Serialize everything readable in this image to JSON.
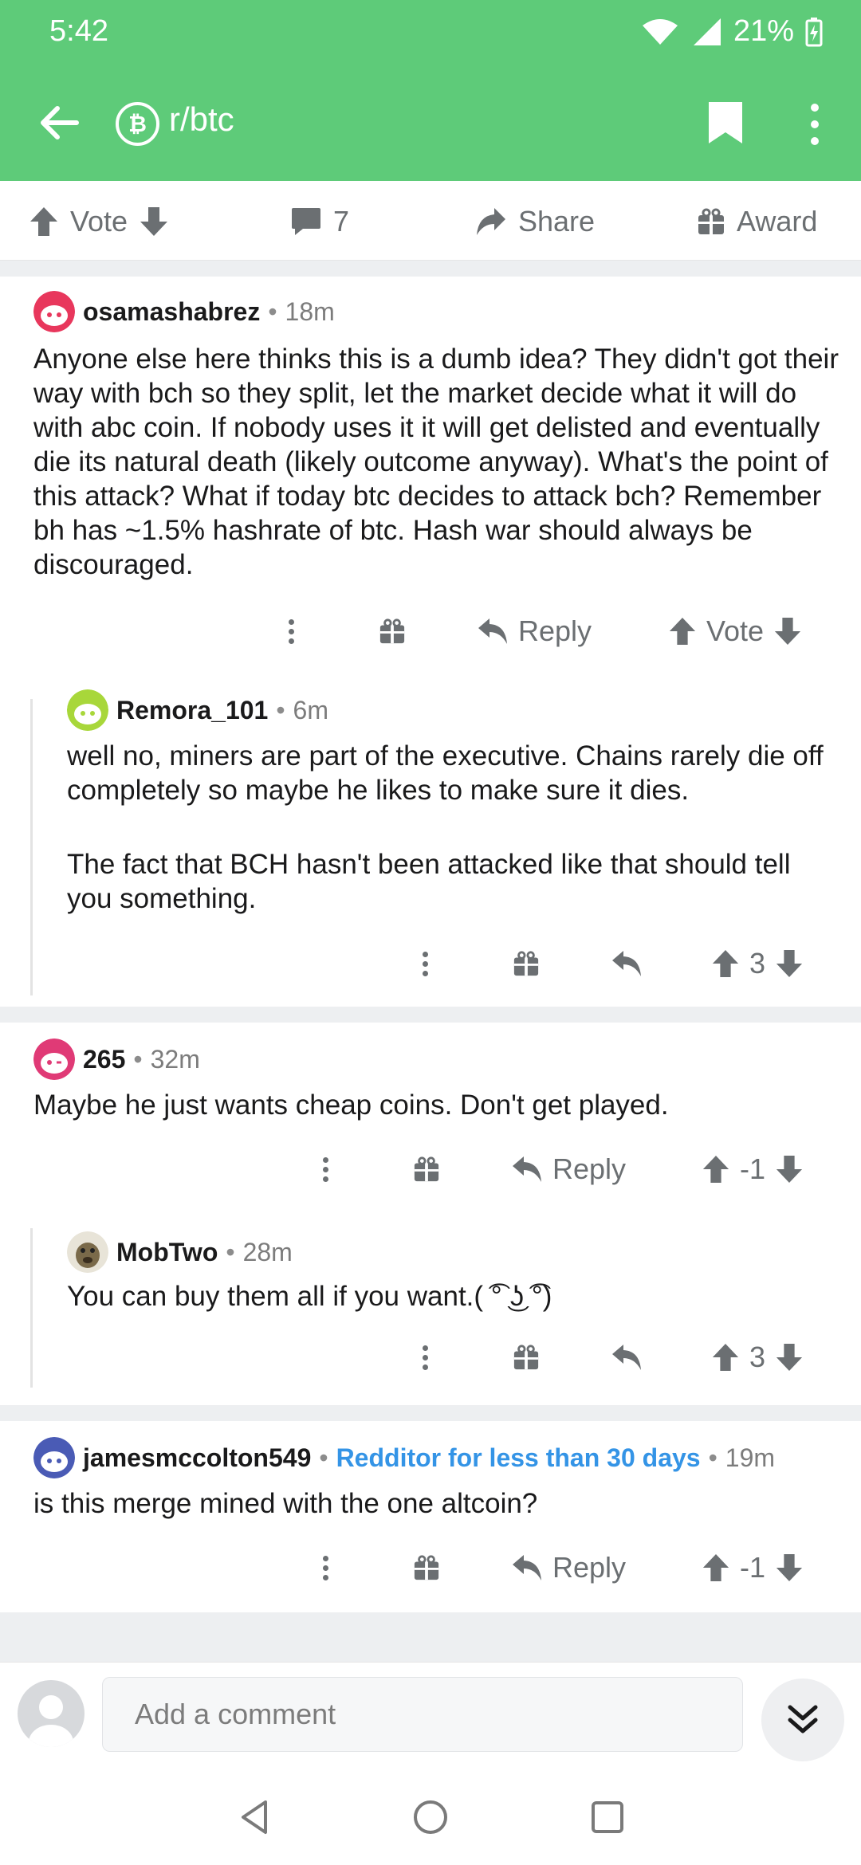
{
  "status": {
    "time": "5:42",
    "battery": "21%"
  },
  "header": {
    "subreddit": "r/btc",
    "sub_icon_letter": "₿"
  },
  "actions": {
    "vote": "Vote",
    "comments_count": "7",
    "share": "Share",
    "award": "Award"
  },
  "comments": [
    {
      "username": "osamashabrez",
      "age": "18m",
      "avatar_color": "#e8375c",
      "body": "Anyone else here thinks this is a dumb idea? They didn't got their way with bch so they split, let the market decide what it will do with abc coin. If nobody uses it it will get delisted and eventually die its natural death (likely outcome anyway). What's the point of this attack? What if today btc decides to attack bch? Remember bh has ~1.5% hashrate of btc. Hash war should always be discouraged.",
      "reply": "Reply",
      "vote": "Vote"
    },
    {
      "username": "Remora_101",
      "age": "6m",
      "avatar_color": "#a8d73a",
      "body_1": "well no, miners are part of the executive. Chains rarely die off completely so maybe he likes to make sure it dies.",
      "body_2": "The fact that BCH hasn't been attacked like that should tell you something.",
      "score": "3"
    },
    {
      "username": "265",
      "age": "32m",
      "avatar_color": "#e03a76",
      "body": "Maybe he just wants cheap coins. Don't get played.",
      "reply": "Reply",
      "score": "-1"
    },
    {
      "username": "MobTwo",
      "age": "28m",
      "avatar_color": "#7a6a4a",
      "body": "You can buy them all if you want.( ͡° ͜ʖ ͡°)",
      "score": "3"
    },
    {
      "username": "jamesmccolton549",
      "flair": "Redditor for less than 30 days",
      "age": "19m",
      "avatar_color": "#4a5bb5",
      "body": "is this merge mined with the one altcoin?",
      "reply": "Reply",
      "score": "-1"
    }
  ],
  "bottom": {
    "placeholder": "Add a comment"
  },
  "colors": {
    "header_bg": "#5ecb79",
    "flair": "#3494e6",
    "icon_gray": "#6b6f72"
  }
}
